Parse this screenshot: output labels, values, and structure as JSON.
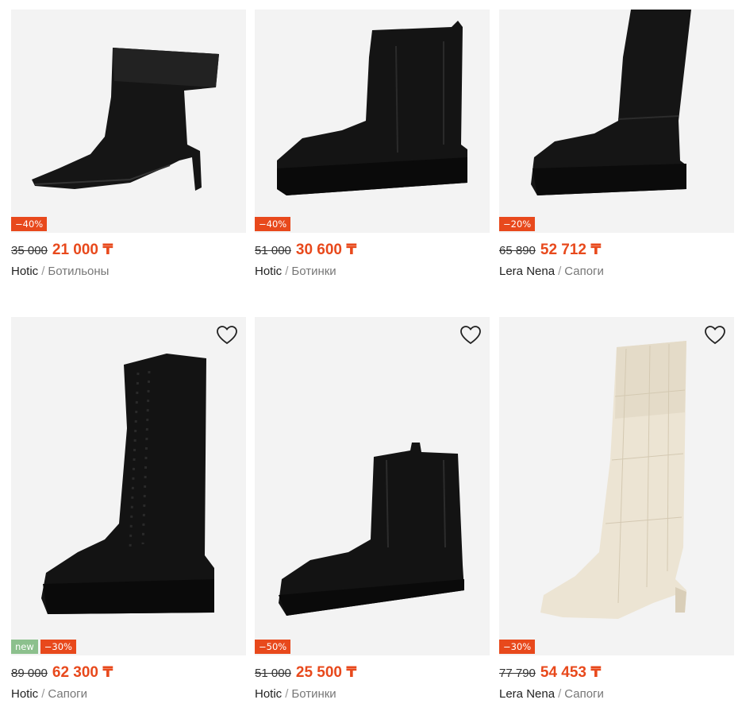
{
  "currency": "₸",
  "colors": {
    "accent": "#e8491c",
    "new_badge": "#8cc08d",
    "card_bg": "#f3f3f3"
  },
  "products": [
    {
      "image": "black-heeled-ankle-boot",
      "badges": [
        "−40%"
      ],
      "favorite_visible": false,
      "old_price": "35 000",
      "price": "21 000 ₸",
      "brand": "Hotic",
      "separator": "/",
      "category": "Ботильоны"
    },
    {
      "image": "black-platform-chelsea-boot",
      "badges": [
        "−40%"
      ],
      "favorite_visible": false,
      "old_price": "51 000",
      "price": "30 600 ₸",
      "brand": "Hotic",
      "separator": "/",
      "category": "Ботинки"
    },
    {
      "image": "black-knee-high-boot",
      "badges": [
        "−20%"
      ],
      "favorite_visible": false,
      "old_price": "65 890",
      "price": "52 712 ₸",
      "brand": "Lera Nena",
      "separator": "/",
      "category": "Сапоги"
    },
    {
      "image": "black-lace-up-tall-boot",
      "badges": [
        "new",
        "−30%"
      ],
      "favorite_visible": true,
      "old_price": "89 000",
      "price": "62 300 ₸",
      "brand": "Hotic",
      "separator": "/",
      "category": "Сапоги"
    },
    {
      "image": "black-chunky-chelsea-boot",
      "badges": [
        "−50%"
      ],
      "favorite_visible": true,
      "old_price": "51 000",
      "price": "25 500 ₸",
      "brand": "Hotic",
      "separator": "/",
      "category": "Ботинки"
    },
    {
      "image": "cream-croc-knee-high-boot",
      "badges": [
        "−30%"
      ],
      "favorite_visible": true,
      "old_price": "77 790",
      "price": "54 453 ₸",
      "brand": "Lera Nena",
      "separator": "/",
      "category": "Сапоги"
    }
  ]
}
